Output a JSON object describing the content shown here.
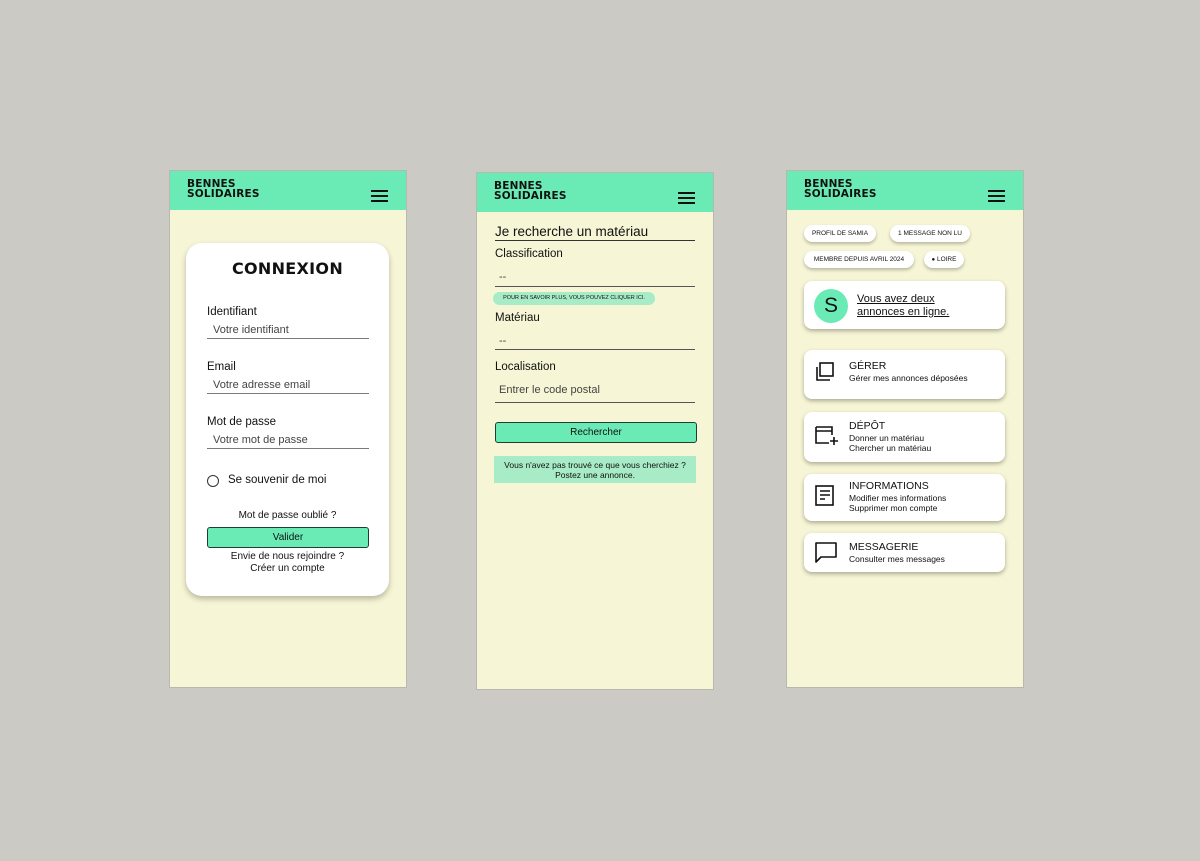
{
  "brand": {
    "line1": "BENNES",
    "line2": "SOLIDAIRES"
  },
  "login": {
    "title": "CONNEXION",
    "identifiant_label": "Identifiant",
    "identifiant_placeholder": "Votre identifiant",
    "email_label": "Email",
    "email_placeholder": "Votre adresse email",
    "password_label": "Mot de passe",
    "password_placeholder": "Votre mot de passe",
    "remember_label": "Se souvenir de moi",
    "forgot_link": "Mot de passe oublié ?",
    "submit_label": "Valider",
    "join_text": "Envie de nous rejoindre ?",
    "create_account_link": "Créer un compte"
  },
  "search": {
    "title": "Je recherche un matériau",
    "classification_label": "Classification",
    "classification_value": "--",
    "info_pill": "POUR EN SAVOIR PLUS, VOUS POUVEZ CLIQUER ICI.",
    "material_label": "Matériau",
    "material_value": "--",
    "location_label": "Localisation",
    "location_placeholder": "Entrer le code postal",
    "search_button": "Rechercher",
    "notice_line1": "Vous n'avez pas trouvé ce que vous cherchiez ?",
    "notice_line2": "Postez une annonce."
  },
  "profile": {
    "chip_profile": "PROFIL DE SAMIA",
    "chip_messages": "1 MESSAGE NON LU",
    "chip_member": "MEMBRE DEPUIS AVRIL 2024",
    "chip_location": "LOIRE",
    "avatar_letter": "S",
    "announce_line1": "Vous avez deux",
    "announce_line2": "annonces en ligne.",
    "tiles": [
      {
        "title": "GÉRER",
        "line1": "Gérer mes annonces déposées",
        "line2": ""
      },
      {
        "title": "DÉPÔT",
        "line1": "Donner un matériau",
        "line2": "Chercher un matériau"
      },
      {
        "title": "INFORMATIONS",
        "line1": "Modifier mes informations",
        "line2": "Supprimer mon compte"
      },
      {
        "title": "MESSAGERIE",
        "line1": "Consulter mes messages",
        "line2": ""
      }
    ]
  },
  "colors": {
    "accent": "#6aebb5",
    "background": "#f6f5d5",
    "page": "#cbcac5"
  }
}
